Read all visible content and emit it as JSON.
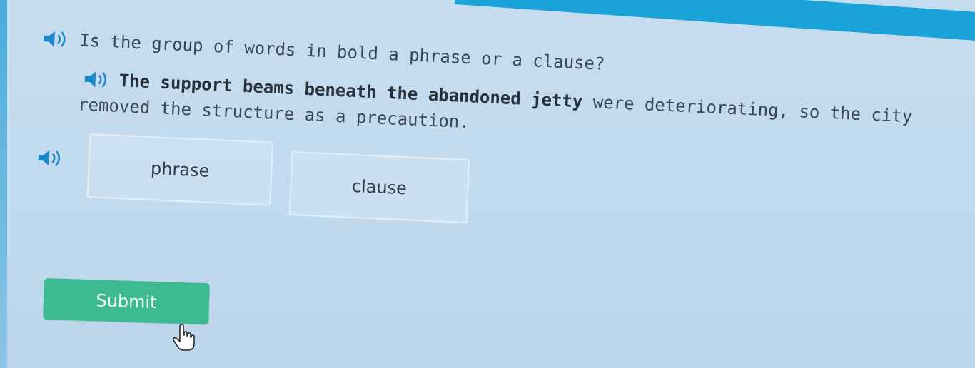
{
  "question": {
    "text": "Is the group of words in bold a phrase or a clause?",
    "audio_icon": "speaker-icon"
  },
  "sentence": {
    "bold_part": "The support beams beneath the abandoned jetty",
    "rest_first_line": " were deteriorating, so the city",
    "second_line": "removed the structure as a precaution.",
    "audio_icon": "speaker-icon"
  },
  "choices": {
    "audio_icon": "speaker-icon",
    "options": [
      {
        "label": "phrase"
      },
      {
        "label": "clause"
      }
    ]
  },
  "submit": {
    "label": "Submit",
    "color": "#3dba92"
  },
  "cursor_icon": "hand-pointer-icon",
  "colors": {
    "accent_band": "#1aa3d9",
    "background": "#c5dcee"
  }
}
